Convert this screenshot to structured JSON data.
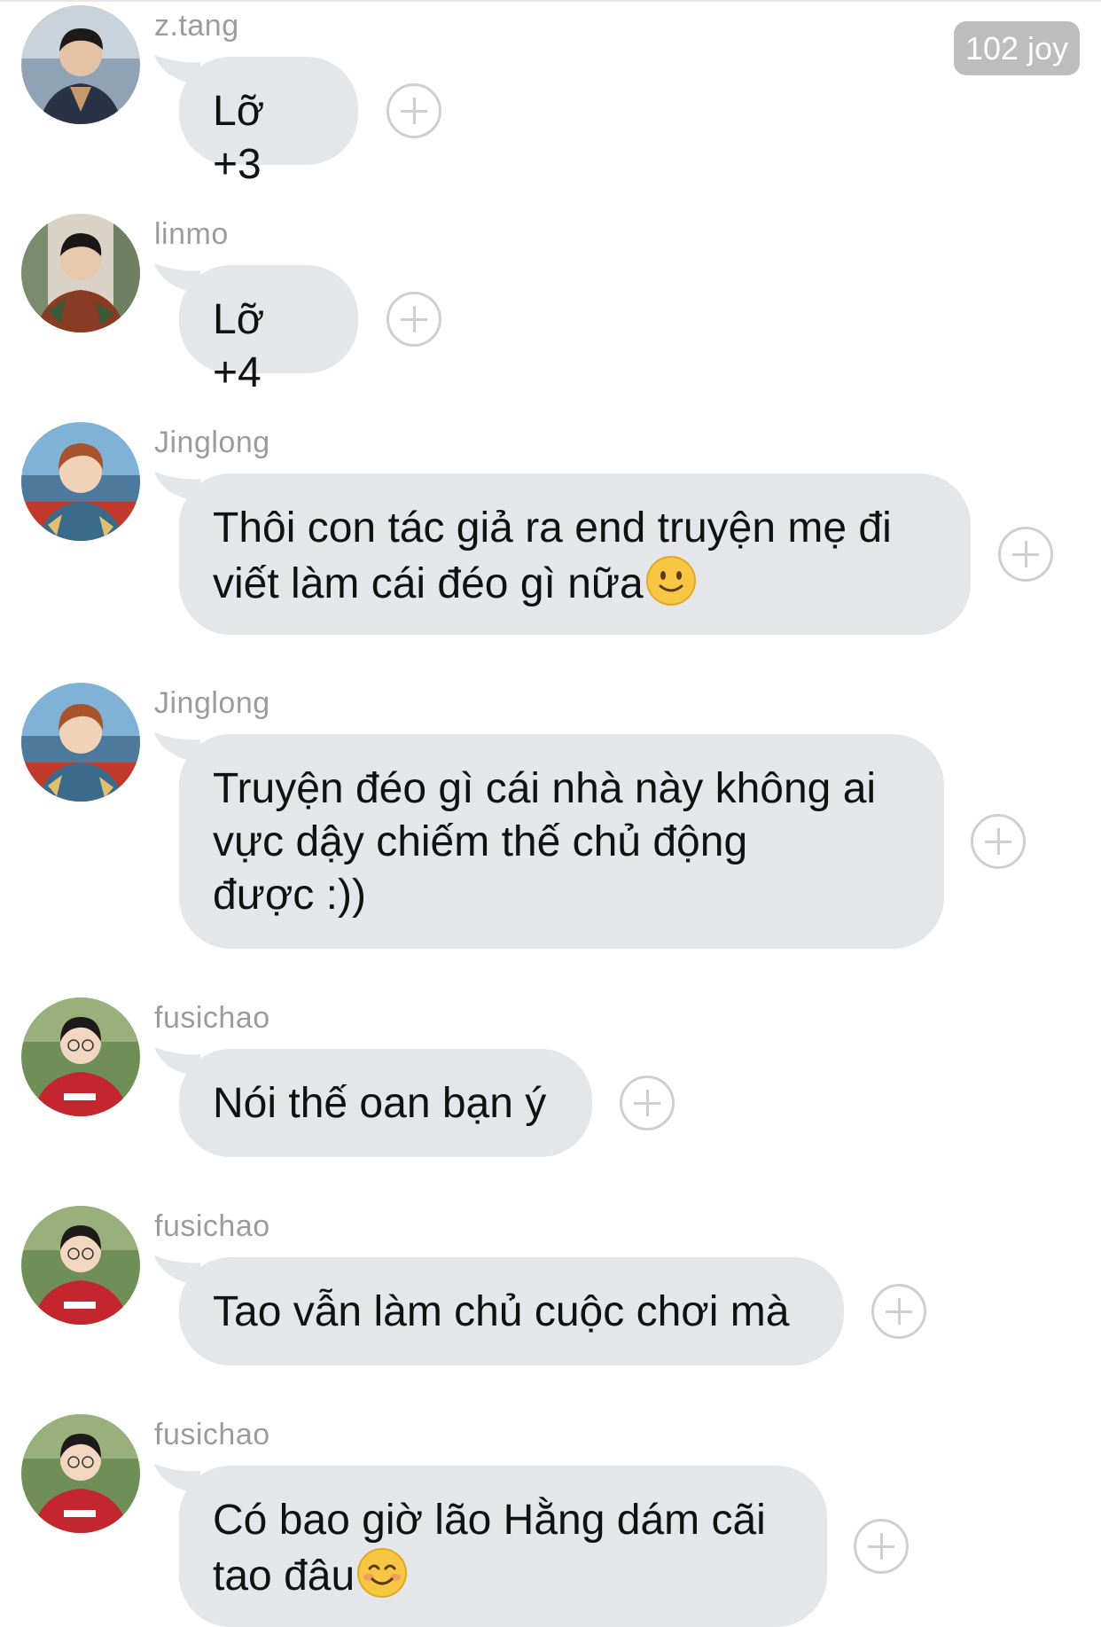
{
  "badge": {
    "label": "102 joy"
  },
  "messages": [
    {
      "user": "z.tang",
      "avatar": "avatar-ztang",
      "lines": [
        "Lỡ +3"
      ],
      "emoji": null
    },
    {
      "user": "linmo",
      "avatar": "avatar-linmo",
      "lines": [
        "Lỡ +4"
      ],
      "emoji": null
    },
    {
      "user": "Jinglong",
      "avatar": "avatar-jinglong",
      "lines": [
        "Thôi con tác giả ra end truyện mẹ đi",
        "viết làm cái đéo gì nữa"
      ],
      "emoji": "slight-smile-emoji"
    },
    {
      "user": "Jinglong",
      "avatar": "avatar-jinglong",
      "lines": [
        "Truyện đéo gì cái nhà này không ai",
        "vực dậy chiếm thế chủ động",
        "được :))"
      ],
      "emoji": null
    },
    {
      "user": "fusichao",
      "avatar": "avatar-fusichao",
      "lines": [
        "Nói thế oan bạn ý"
      ],
      "emoji": null
    },
    {
      "user": "fusichao",
      "avatar": "avatar-fusichao",
      "lines": [
        "Tao vẫn làm chủ cuộc chơi mà"
      ],
      "emoji": null
    },
    {
      "user": "fusichao",
      "avatar": "avatar-fusichao",
      "lines": [
        "Có bao giờ lão Hằng dám cãi",
        "tao đâu"
      ],
      "emoji": "blush-smile-emoji"
    }
  ],
  "colors": {
    "bubble": "#e4e6ea",
    "name": "#9c9c9c",
    "badge": "#bdbdbd",
    "plus": "#cfcfcf"
  }
}
